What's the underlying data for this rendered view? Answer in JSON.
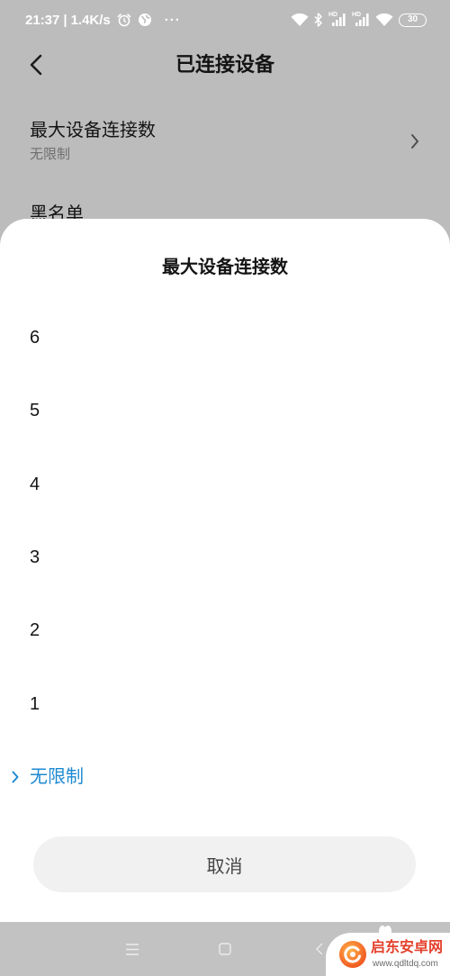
{
  "status_bar": {
    "time": "21:37",
    "divider": "|",
    "net_speed": "1.4K/s",
    "more": "···",
    "hd_label": "HD",
    "battery_level": "30",
    "left_icons": [
      "alarm-icon",
      "globe-icon"
    ],
    "right_icons": [
      "wifi-icon",
      "bluetooth-icon",
      "signal-icon",
      "signal-icon",
      "wifi-icon",
      "battery-icon"
    ]
  },
  "header": {
    "back_icon": "back-arrow-icon",
    "title": "已连接设备"
  },
  "settings": {
    "max_connections": {
      "label": "最大设备连接数",
      "value": "无限制",
      "icon": "chevron-right-icon"
    },
    "blacklist": {
      "label": "黑名单"
    }
  },
  "sheet": {
    "title": "最大设备连接数",
    "options": [
      {
        "label": "6",
        "selected": false
      },
      {
        "label": "5",
        "selected": false
      },
      {
        "label": "4",
        "selected": false
      },
      {
        "label": "3",
        "selected": false
      },
      {
        "label": "2",
        "selected": false
      },
      {
        "label": "1",
        "selected": false
      },
      {
        "label": "无限制",
        "selected": true
      }
    ],
    "selected_icon": "chevron-right-icon",
    "cancel_label": "取消"
  },
  "nav_bar": {
    "icons": [
      "menu-icon",
      "home-square-icon",
      "back-icon"
    ]
  },
  "watermark": {
    "name": "启东安卓网",
    "url": "www.qdltdq.com"
  },
  "colors": {
    "dim_background": "#bcbcbc",
    "sheet_background": "#ffffff",
    "accent": "#1f8ad3",
    "primary_text": "#141414",
    "secondary_text": "#6f6f6f",
    "cancel_button": "#f1f1f1",
    "cancel_text": "#454545",
    "nav_bar": "#c2c2c2",
    "nav_icon": "#ececec",
    "status_text": "#ffffff",
    "watermark_red": "#e4402b",
    "watermark_gray": "#6a6a6a"
  }
}
